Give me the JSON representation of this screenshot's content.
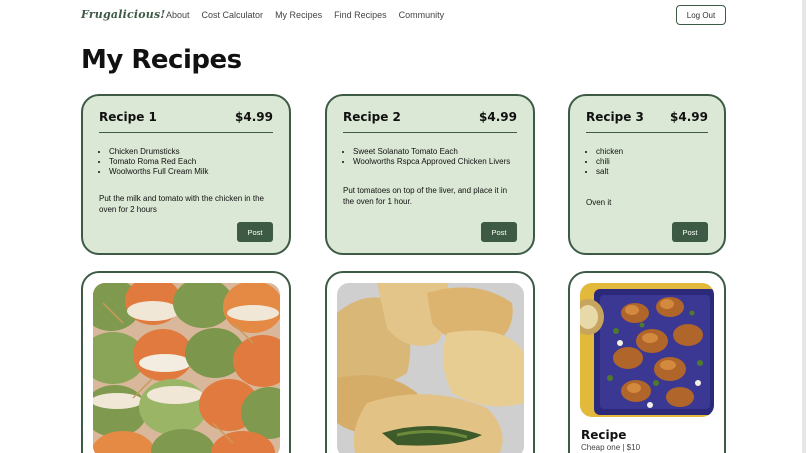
{
  "nav": {
    "brand": "Frugalicious!",
    "links": [
      "About",
      "Cost Calculator",
      "My Recipes",
      "Find Recipes",
      "Community"
    ],
    "logout": "Log Out"
  },
  "page": {
    "title": "My Recipes"
  },
  "recipes": [
    {
      "title": "Recipe 1",
      "price": "$4.99",
      "ingredients": [
        "Chicken Drumsticks",
        "Tomato Roma Red Each",
        "Woolworths Full Cream Milk"
      ],
      "description": "Put the milk and tomato with the chicken in the oven for 2 hours",
      "post": "Post"
    },
    {
      "title": "Recipe 2",
      "price": "$4.99",
      "ingredients": [
        "Sweet Solanato Tomato Each",
        "Woolworths Rspca Approved Chicken Livers"
      ],
      "description": "Put tomatoes on top of the liver, and place it in the oven for 1 hour.",
      "post": "Post"
    },
    {
      "title": "Recipe 3",
      "price": "$4.99",
      "ingredients": [
        "chicken",
        "chili",
        "salt"
      ],
      "description": "Oven it",
      "post": "Post"
    }
  ],
  "gallery": [
    {
      "image": "tricolor-idli-photo"
    },
    {
      "image": "fried-pastries-photo"
    },
    {
      "image": "roast-chicken-tray-photo",
      "title": "Recipe",
      "meta": "Cheap one  |  $10"
    }
  ],
  "colors": {
    "accent": "#3d5a45",
    "card_bg": "#dbe8d5"
  }
}
